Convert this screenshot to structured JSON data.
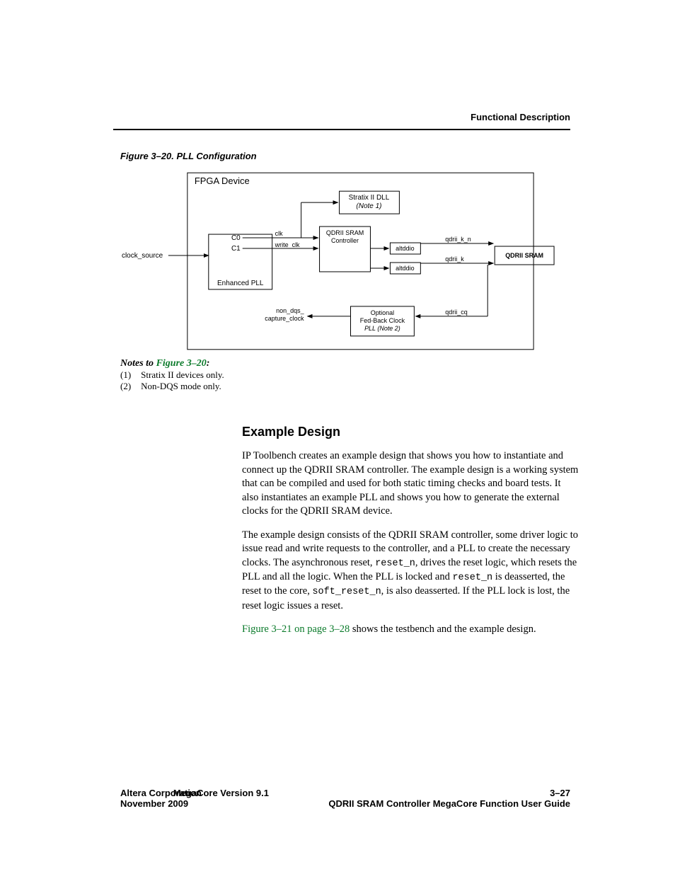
{
  "header": {
    "section": "Functional Description"
  },
  "figure": {
    "caption": "Figure 3–20. PLL Configuration",
    "labels": {
      "fpga": "FPGA Device",
      "enhanced_pll": "Enhanced PLL",
      "clock_source": "clock_source",
      "dll_line1": "Stratix II DLL",
      "dll_line2": "(Note 1)",
      "ctrl_line1": "QDRII SRAM",
      "ctrl_line2": "Controller",
      "altddio": "altddio",
      "sram": "QDRII SRAM",
      "fbpll_line1": "Optional",
      "fbpll_line2": "Fed-Back Clock",
      "fbpll_line3": "PLL (Note 2)",
      "c0": "C0",
      "c1": "C1",
      "clk": "clk",
      "write_clk": "write_clk",
      "non_dqs_l1": "non_dqs_",
      "non_dqs_l2": "capture_clock",
      "k_n": "qdrii_k_n",
      "k": "qdrii_k",
      "cq": "qdrii_cq"
    }
  },
  "notes": {
    "title_lead": "Notes to ",
    "title_ref": "Figure 3–20",
    "title_trail": ":",
    "items": [
      {
        "num": "(1)",
        "text": "Stratix II devices only."
      },
      {
        "num": "(2)",
        "text": "Non-DQS mode only."
      }
    ]
  },
  "section": {
    "title": "Example Design"
  },
  "paragraphs": {
    "p1": "IP Toolbench creates an example design that shows you how to instantiate and connect up the QDRII SRAM controller. The example design is a working system that can be compiled and used for both static timing checks and board tests. It also instantiates an example PLL and shows you how to generate the external clocks for the QDRII SRAM device.",
    "p2_a": "The example design consists of the QDRII SRAM controller, some driver logic to issue read and write requests to the controller, and a PLL to create the necessary clocks. The asynchronous reset, ",
    "p2_code1": "reset_n",
    "p2_b": ", drives the reset logic, which resets the PLL and all the logic. When the PLL is locked and ",
    "p2_code2": "reset_n",
    "p2_c": " is deasserted, the reset to the core, ",
    "p2_code3": "soft_reset_n",
    "p2_d": ", is also deasserted. If the PLL lock is lost, the reset logic issues a reset.",
    "p3_link": "Figure 3–21 on page 3–28",
    "p3_rest": " shows the testbench and the example design."
  },
  "footer": {
    "left_l1": "Altera Corporation",
    "left_l2": "November 2009",
    "center": "MegaCore Version 9.1",
    "right_l1": "3–27",
    "right_l2": "QDRII SRAM Controller MegaCore Function User Guide"
  }
}
